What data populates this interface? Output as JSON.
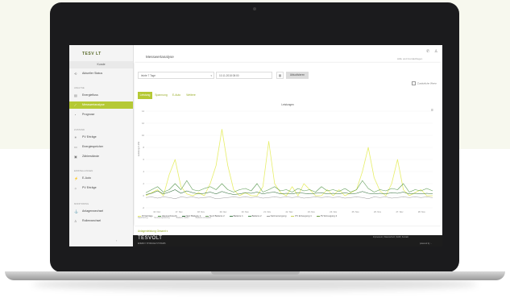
{
  "sidebar": {
    "logo": "TESV LT",
    "kunde": "Kunde",
    "sections": [
      "ANALYSE",
      "ZUSTAND",
      "EINSTELLUNGEN",
      "MONITORING"
    ],
    "items": [
      {
        "icon": "refresh-icon",
        "glyph": "⟲",
        "label": "Aktueller Status"
      },
      {
        "icon": "chart-icon",
        "glyph": "▤",
        "label": "Energiefluss"
      },
      {
        "icon": "line-chart-icon",
        "glyph": "⟋",
        "label": "Messwertanalyse"
      },
      {
        "icon": "clock-icon",
        "glyph": "◔",
        "label": "Prognose"
      },
      {
        "icon": "solar-icon",
        "glyph": "☀",
        "label": "PV Erträge"
      },
      {
        "icon": "battery-icon",
        "glyph": "▭",
        "label": "Energiespeicher"
      },
      {
        "icon": "meter-icon",
        "glyph": "▣",
        "label": "Zählerstände"
      },
      {
        "icon": "car-icon",
        "glyph": "⚡",
        "label": "E-Auto"
      },
      {
        "icon": "sun-icon",
        "glyph": "☼",
        "label": "PV Erträge"
      },
      {
        "icon": "anchor-icon",
        "glyph": "⚓",
        "label": "Anlagenwechsel"
      },
      {
        "icon": "user-icon",
        "glyph": "♙",
        "label": "Rollenwechsel"
      }
    ],
    "collapse_glyph": "‹"
  },
  "header": {
    "title": "Messwertanalyse",
    "phone_glyph": "✆",
    "user_glyph": "♙",
    "link": "Hilfe und Kontaktfragen"
  },
  "filters": {
    "range": "letzte 7 Tage",
    "datetime": "10.11.2018 08:00",
    "update_label": "Aktualisieren",
    "compare_label": "Zusätzliche Werte"
  },
  "tabs": [
    "Leistung",
    "Spannung",
    "E-Auto",
    "Weitere"
  ],
  "chart_title": "Leistungen",
  "menu_glyph": "≡",
  "ylabel": "Leistung in kW",
  "legend": [
    "PV Erträge",
    "Hausverbrauch",
    "Netz Batterie 1",
    "Netz Batterie 2",
    "Batterie 1",
    "Batterie 2",
    "Netzversorgung",
    "PV Erzeugung 1",
    "PV Erzeugung 2"
  ],
  "legend_sub": [
    "Netzbezug",
    "Netzeinspeisung",
    "Batterie laden",
    "Batterie entladen"
  ],
  "accordion": [
    "Anlagenleistung Hinsichtlich",
    "Anlagenleistung Gesamt"
  ],
  "footer": {
    "logo": "TESVOLT",
    "tagline": "ENERGY STORAGE SYSTEMS",
    "links": "Impressum | Datenschutz | AGB | Kontakt",
    "powered": "powered by ..."
  },
  "colors": {
    "accent": "#b5c935",
    "pv": "#e7ee6a",
    "green1": "#5b9a52",
    "green2": "#2f6b37",
    "grey": "#9c9c9c"
  },
  "chart_data": {
    "type": "line",
    "title": "Leistungen",
    "ylabel": "Leistung in kW",
    "ylim": [
      -2,
      14
    ],
    "yticks": [
      14,
      12,
      10,
      8,
      6,
      4,
      2,
      0,
      -2
    ],
    "xticks": [
      "16. Nov",
      "17. Nov",
      "18. Nov",
      "19. Nov",
      "20. Nov",
      "21. Nov",
      "22. Nov",
      "23. Nov",
      "24. Nov",
      "25. Nov",
      "26. Nov",
      "27. Nov",
      "28. Nov"
    ],
    "series": [
      {
        "name": "PV Erträge",
        "color": "#e7ee6a",
        "values": [
          0,
          0.5,
          1,
          0,
          3.5,
          6,
          1.5,
          0.3,
          0,
          0.5,
          0,
          2,
          5,
          11,
          5,
          1,
          0,
          0.5,
          0,
          0,
          1.5,
          9,
          2,
          0.5,
          0,
          1.5,
          0,
          2,
          1,
          0,
          0,
          1,
          0,
          1,
          0,
          0.5,
          1,
          4,
          8,
          3,
          0.8,
          0,
          2,
          6,
          1,
          0,
          0.5,
          1,
          0,
          0
        ]
      },
      {
        "name": "Hausverbrauch",
        "color": "#5b9a52",
        "values": [
          0.5,
          1,
          1.5,
          0.6,
          1,
          2,
          1,
          2.5,
          1,
          0.8,
          1.2,
          1.5,
          1,
          2,
          1,
          0.6,
          1,
          1.2,
          0.8,
          2,
          0.6,
          1,
          1.5,
          0.8,
          1,
          0.6,
          1.2,
          0.8,
          1,
          0.6,
          1.5,
          0.8,
          1,
          0.7,
          1.2,
          0.6,
          1,
          2.5,
          1.2,
          0.6,
          1,
          0.8,
          1.2,
          1,
          2,
          0.6,
          1,
          0.8,
          1.2,
          0.8
        ]
      },
      {
        "name": "Batterie 1",
        "color": "#2f6b37",
        "values": [
          0.2,
          0.4,
          0.8,
          0.3,
          0.6,
          1,
          0.4,
          0.8,
          0.5,
          0.3,
          0.4,
          0.6,
          0.3,
          0.7,
          0.4,
          0.2,
          0.3,
          0.5,
          0.4,
          0.6,
          0.3,
          0.5,
          0.6,
          0.3,
          0.4,
          0.3,
          0.5,
          0.4,
          0.3,
          0.4,
          0.5,
          0.3,
          0.4,
          0.3,
          0.5,
          0.3,
          0.4,
          0.7,
          0.4,
          0.3,
          0.4,
          0.3,
          0.5,
          0.4,
          0.6,
          0.3,
          0.4,
          0.3,
          0.4,
          0.3
        ]
      },
      {
        "name": "Netzversorgung",
        "color": "#9c9c9c",
        "values": [
          -0.3,
          -0.2,
          -0.4,
          -0.2,
          -0.3,
          -0.5,
          -0.2,
          -0.3,
          -0.2,
          -0.4,
          -0.3,
          -0.2,
          -0.5,
          -0.4,
          -0.3,
          -0.2,
          -0.3,
          -0.2,
          -0.3,
          -0.2,
          -0.4,
          -0.3,
          -0.2,
          -0.3,
          -0.2,
          -0.3,
          -0.2,
          -0.4,
          -0.3,
          -0.2,
          -0.3,
          -0.2,
          -0.3,
          -0.2,
          -0.4,
          -0.3,
          -0.2,
          -0.3,
          -0.5,
          -0.2,
          -0.3,
          -0.2,
          -0.4,
          -0.3,
          -0.2,
          -0.3,
          -0.2,
          -0.3,
          -0.2,
          -0.3
        ]
      }
    ]
  }
}
